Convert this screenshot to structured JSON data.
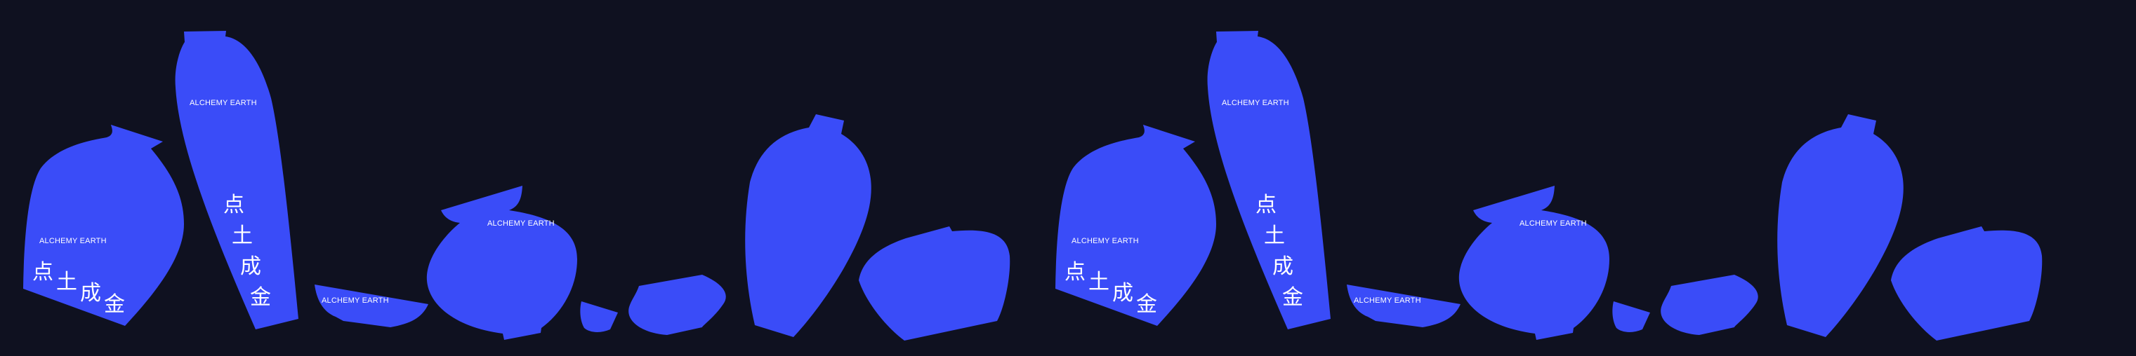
{
  "colors": {
    "background": "#0f1120",
    "vessel": "#3a4cf8",
    "text": "#ffffff"
  },
  "labels": {
    "brand": "ALCHEMY EARTH",
    "char1": "点",
    "char2": "土",
    "char3": "成",
    "char4": "金"
  }
}
